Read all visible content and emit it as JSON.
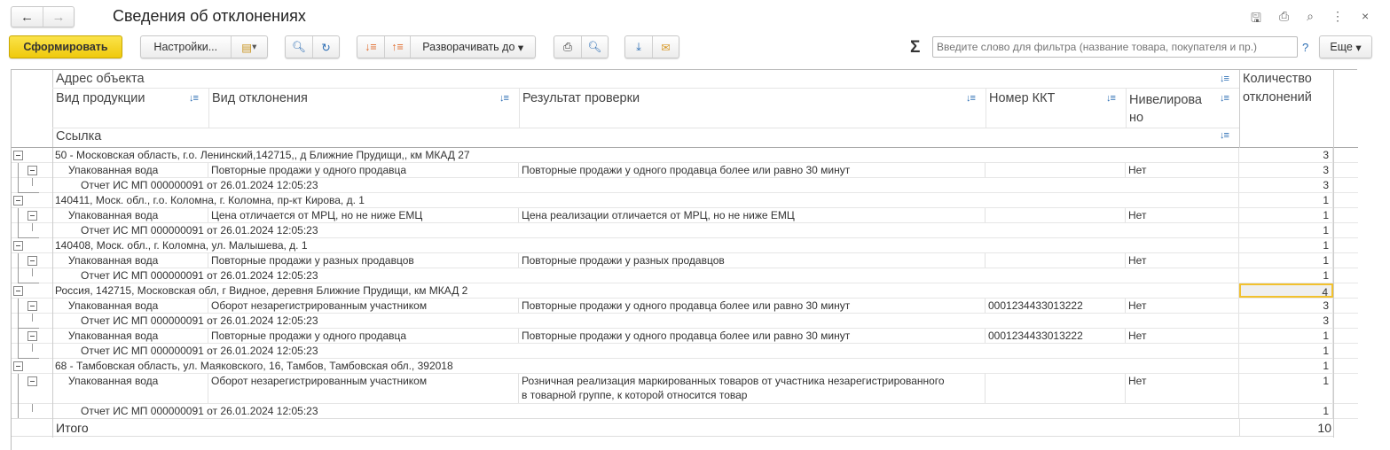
{
  "window": {
    "title": "Сведения об отклонениях",
    "nav_back": "←",
    "nav_forward": "→"
  },
  "toolbar": {
    "generate": "Сформировать",
    "settings": "Настройки...",
    "expand_to": "Разворачивать до",
    "sigma": "Σ",
    "filter_placeholder": "Введите слово для фильтра (название товара, покупателя и пр.)",
    "help": "?",
    "more": "Еще"
  },
  "colors": {
    "accent": "#f5d21a",
    "selection": "#f2c12e"
  },
  "headers": {
    "address": "Адрес объекта",
    "product": "Вид продукции",
    "deviation": "Вид отклонения",
    "result": "Результат проверки",
    "kkt": "Номер ККТ",
    "leveled": "Нивелирова но",
    "qty": "Количество отклонений",
    "link": "Ссылка"
  },
  "rows": [
    {
      "type": "group",
      "text": "50 - Московская область, г.о. Ленинский,142715,, д Ближние Прудищи,, км МКАД 27",
      "qty": "3"
    },
    {
      "type": "detail",
      "product": "Упакованная вода",
      "deviation": "Повторные продажи у одного продавца",
      "result": "Повторные продажи у одного продавца более или равно 30 минут",
      "kkt": "",
      "leveled": "Нет",
      "qty": "3"
    },
    {
      "type": "ref",
      "text": "Отчет ИС МП 000000091 от 26.01.2024 12:05:23",
      "qty": "3"
    },
    {
      "type": "group",
      "text": "140411, Моск. обл., г.о. Коломна, г. Коломна, пр-кт Кирова, д. 1",
      "qty": "1"
    },
    {
      "type": "detail",
      "product": "Упакованная вода",
      "deviation": "Цена отличается от МРЦ, но не ниже ЕМЦ",
      "result": "Цена реализации отличается от МРЦ, но не ниже ЕМЦ",
      "kkt": "",
      "leveled": "Нет",
      "qty": "1"
    },
    {
      "type": "ref",
      "text": "Отчет ИС МП 000000091 от 26.01.2024 12:05:23",
      "qty": "1"
    },
    {
      "type": "group",
      "text": "140408, Моск. обл., г. Коломна, ул. Малышева, д. 1",
      "qty": "1"
    },
    {
      "type": "detail",
      "product": "Упакованная вода",
      "deviation": "Повторные продажи у разных продавцов",
      "result": "Повторные продажи у разных продавцов",
      "kkt": "",
      "leveled": "Нет",
      "qty": "1"
    },
    {
      "type": "ref",
      "text": "Отчет ИС МП 000000091 от 26.01.2024 12:05:23",
      "qty": "1"
    },
    {
      "type": "group",
      "text": "Россия, 142715, Московская обл, г Видное, деревня Ближние Прудищи, км МКАД 2",
      "qty": "4",
      "selected": true
    },
    {
      "type": "detail",
      "product": "Упакованная вода",
      "deviation": "Оборот незарегистрированным участником",
      "result": "Повторные продажи у одного продавца более или равно 30 минут",
      "kkt": "0001234433013222",
      "leveled": "Нет",
      "qty": "3"
    },
    {
      "type": "ref",
      "text": "Отчет ИС МП 000000091 от 26.01.2024 12:05:23",
      "qty": "3"
    },
    {
      "type": "detail",
      "product": "Упакованная вода",
      "deviation": "Повторные продажи у одного продавца",
      "result": "Повторные продажи у одного продавца более или равно 30 минут",
      "kkt": "0001234433013222",
      "leveled": "Нет",
      "qty": "1"
    },
    {
      "type": "ref",
      "text": "Отчет ИС МП 000000091 от 26.01.2024 12:05:23",
      "qty": "1"
    },
    {
      "type": "group",
      "text": "68 - Тамбовская область, ул. Маяковского, 16, Тамбов, Тамбовская обл., 392018",
      "qty": "1"
    },
    {
      "type": "detail",
      "tall": true,
      "product": "Упакованная вода",
      "deviation": "Оборот незарегистрированным участником",
      "result": "Розничная реализация маркированных товаров от участника незарегистрированного",
      "result2": "в товарной группе, к которой относится товар",
      "kkt": "",
      "leveled": "Нет",
      "qty": "1"
    },
    {
      "type": "ref",
      "text": "Отчет ИС МП 000000091 от 26.01.2024 12:05:23",
      "qty": "1"
    }
  ],
  "total": {
    "label": "Итого",
    "qty": "10"
  }
}
